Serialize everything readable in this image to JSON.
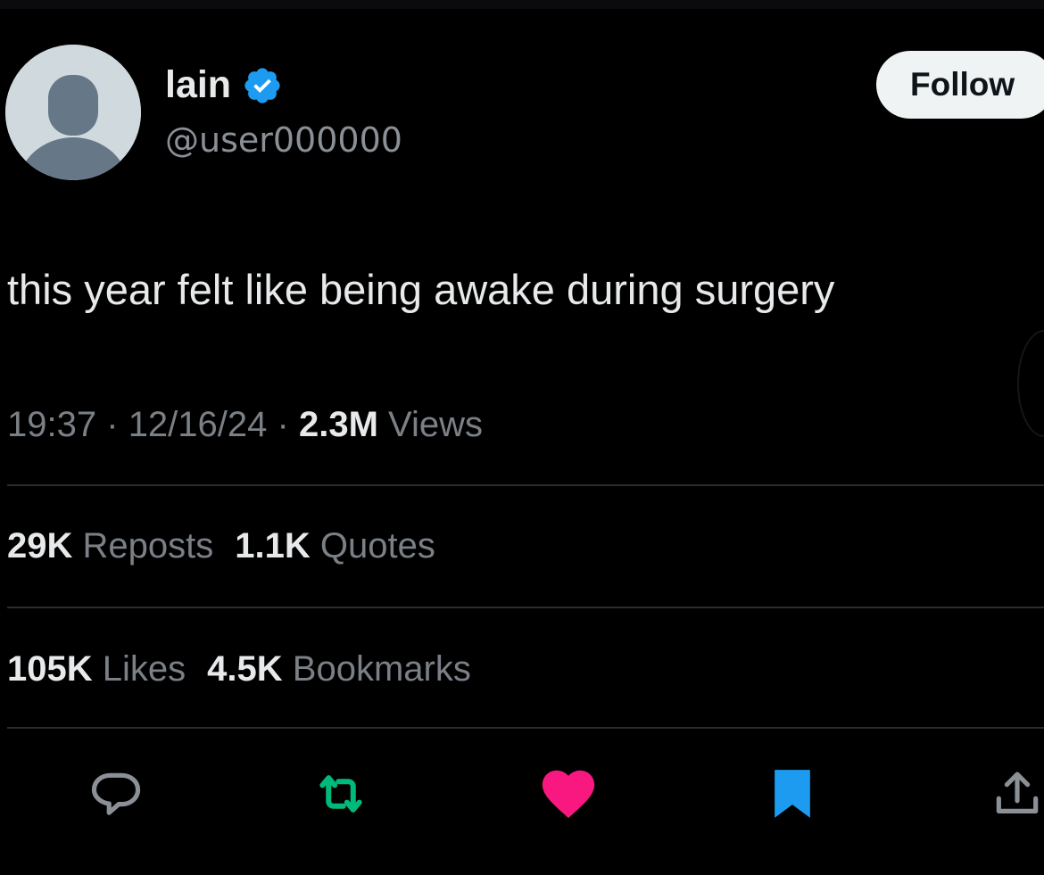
{
  "author": {
    "display_name": "lain",
    "handle": "@user000000",
    "verified": true,
    "avatar_icon": "default-profile-avatar-icon",
    "verified_icon": "verified-badge-icon"
  },
  "follow_button": {
    "label": "Follow"
  },
  "tweet": {
    "text": "this year felt like being awake during surgery",
    "time": "19:37",
    "date": "12/16/24",
    "separator": "·",
    "views_count": "2.3M",
    "views_label": "Views"
  },
  "stats": {
    "reposts_count": "29K",
    "reposts_label": "Reposts",
    "quotes_count": "1.1K",
    "quotes_label": "Quotes",
    "likes_count": "105K",
    "likes_label": "Likes",
    "bookmarks_count": "4.5K",
    "bookmarks_label": "Bookmarks"
  },
  "actions": [
    {
      "name": "reply",
      "icon": "reply-bubble-icon",
      "color": "#71767b"
    },
    {
      "name": "repost",
      "icon": "repost-arrows-icon",
      "color": "#00ba7c"
    },
    {
      "name": "like",
      "icon": "heart-icon",
      "color": "#f91880"
    },
    {
      "name": "bookmark",
      "icon": "bookmark-icon",
      "color": "#1d9bf0"
    },
    {
      "name": "share",
      "icon": "share-upload-icon",
      "color": "#71767b"
    }
  ],
  "colors": {
    "background": "#000000",
    "text_primary": "#e7e9ea",
    "text_secondary": "#71767b",
    "verified_blue": "#1d9bf0",
    "follow_button_bg": "#eff3f4"
  }
}
